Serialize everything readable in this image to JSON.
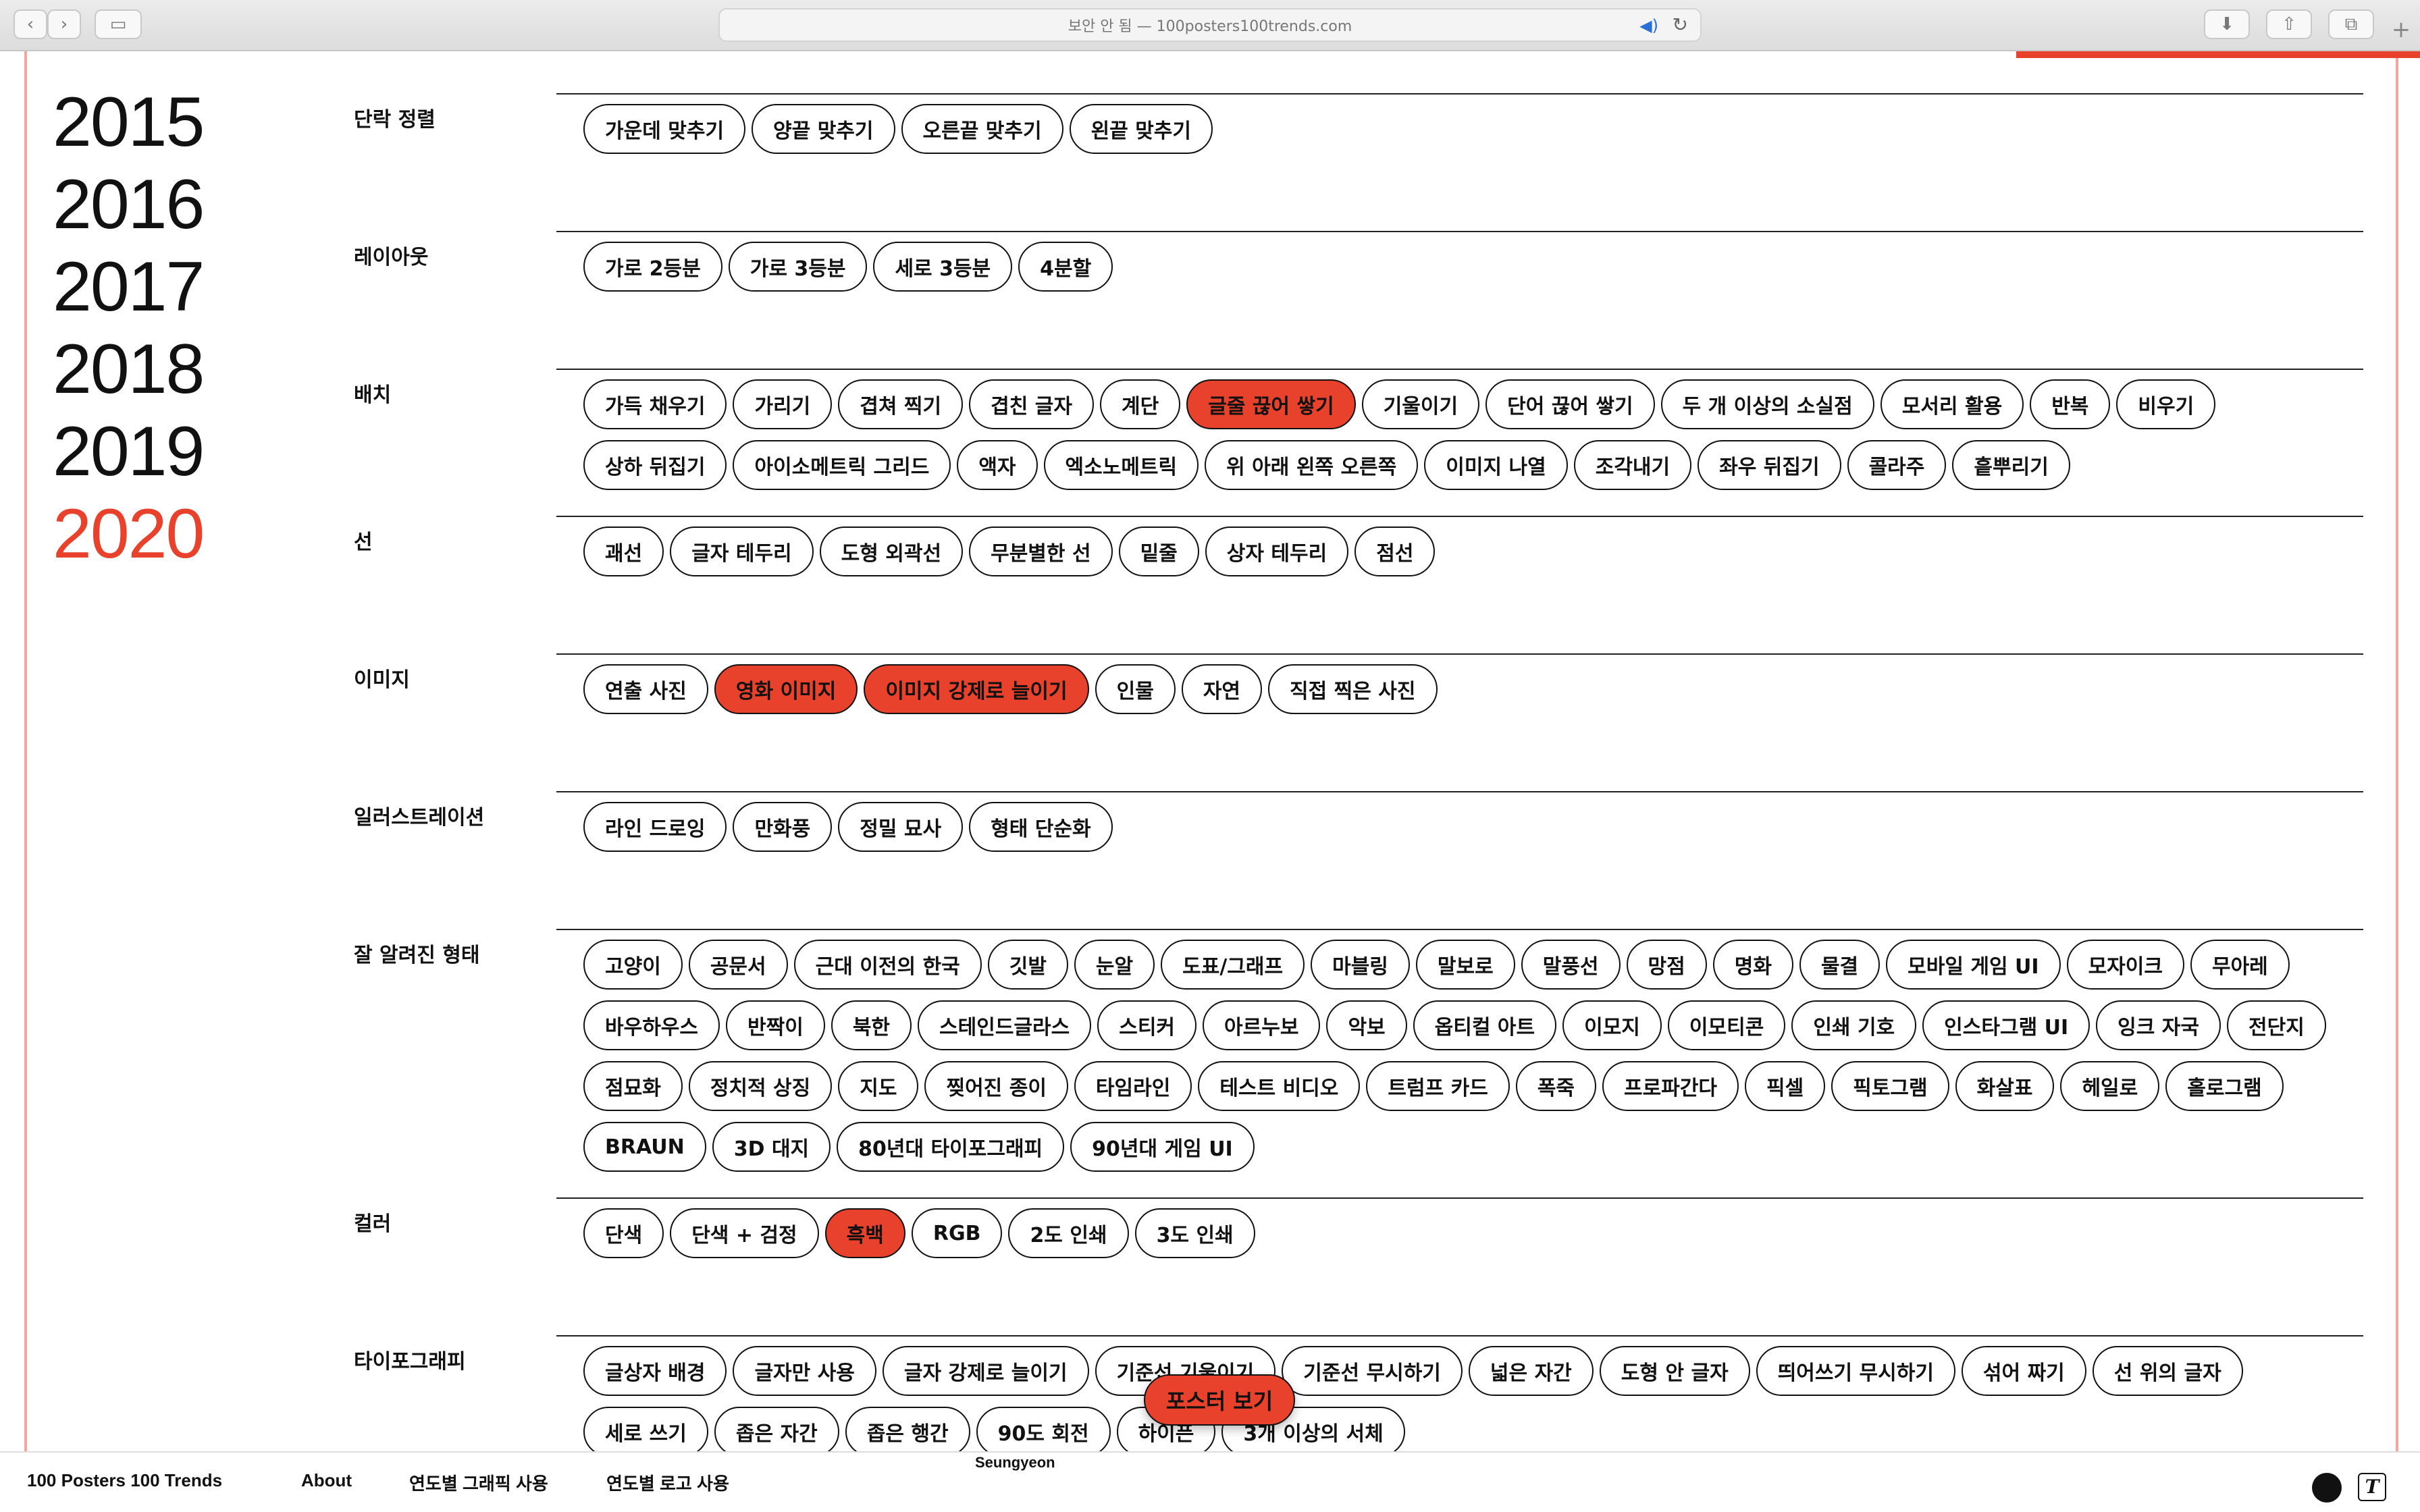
{
  "browser": {
    "address": "보안 안 됨 — 100posters100trends.com"
  },
  "years": [
    {
      "label": "2015",
      "active": false
    },
    {
      "label": "2016",
      "active": false
    },
    {
      "label": "2017",
      "active": false
    },
    {
      "label": "2018",
      "active": false
    },
    {
      "label": "2019",
      "active": false
    },
    {
      "label": "2020",
      "active": true
    }
  ],
  "categories": [
    {
      "title": "단락 정렬",
      "tags": [
        {
          "label": "가운데 맞추기"
        },
        {
          "label": "양끝 맞추기"
        },
        {
          "label": "오른끝 맞추기"
        },
        {
          "label": "왼끝 맞추기"
        }
      ]
    },
    {
      "title": "레이아웃",
      "tags": [
        {
          "label": "가로 2등분"
        },
        {
          "label": "가로 3등분"
        },
        {
          "label": "세로 3등분"
        },
        {
          "label": "4분할"
        }
      ]
    },
    {
      "title": "배치",
      "tags": [
        {
          "label": "가득 채우기"
        },
        {
          "label": "가리기"
        },
        {
          "label": "겹쳐 찍기"
        },
        {
          "label": "겹친 글자"
        },
        {
          "label": "계단"
        },
        {
          "label": "글줄 끊어 쌓기",
          "on": true
        },
        {
          "label": "기울이기"
        },
        {
          "label": "단어 끊어 쌓기"
        },
        {
          "label": "두 개 이상의 소실점"
        },
        {
          "label": "모서리 활용"
        },
        {
          "label": "반복"
        },
        {
          "label": "비우기"
        },
        {
          "label": "상하 뒤집기"
        },
        {
          "label": "아이소메트릭 그리드"
        },
        {
          "label": "액자"
        },
        {
          "label": "엑소노메트릭"
        },
        {
          "label": "위 아래 왼쪽 오른쪽"
        },
        {
          "label": "이미지 나열"
        },
        {
          "label": "조각내기"
        },
        {
          "label": "좌우 뒤집기"
        },
        {
          "label": "콜라주"
        },
        {
          "label": "흩뿌리기"
        }
      ]
    },
    {
      "title": "선",
      "tags": [
        {
          "label": "괘선"
        },
        {
          "label": "글자 테두리"
        },
        {
          "label": "도형 외곽선"
        },
        {
          "label": "무분별한 선"
        },
        {
          "label": "밑줄"
        },
        {
          "label": "상자 테두리"
        },
        {
          "label": "점선"
        }
      ]
    },
    {
      "title": "이미지",
      "tags": [
        {
          "label": "연출 사진"
        },
        {
          "label": "영화 이미지",
          "on": true
        },
        {
          "label": "이미지 강제로 늘이기",
          "on": true
        },
        {
          "label": "인물"
        },
        {
          "label": "자연"
        },
        {
          "label": "직접 찍은 사진"
        }
      ]
    },
    {
      "title": "일러스트레이션",
      "tags": [
        {
          "label": "라인 드로잉"
        },
        {
          "label": "만화풍"
        },
        {
          "label": "정밀 묘사"
        },
        {
          "label": "형태 단순화"
        }
      ]
    },
    {
      "title": "잘 알려진 형태",
      "tags": [
        {
          "label": "고양이"
        },
        {
          "label": "공문서"
        },
        {
          "label": "근대 이전의 한국"
        },
        {
          "label": "깃발"
        },
        {
          "label": "눈알"
        },
        {
          "label": "도표/그래프"
        },
        {
          "label": "마블링"
        },
        {
          "label": "말보로"
        },
        {
          "label": "말풍선"
        },
        {
          "label": "망점"
        },
        {
          "label": "명화"
        },
        {
          "label": "물결"
        },
        {
          "label": "모바일 게임 UI"
        },
        {
          "label": "모자이크"
        },
        {
          "label": "무아레"
        },
        {
          "label": "바우하우스"
        },
        {
          "label": "반짝이"
        },
        {
          "label": "북한"
        },
        {
          "label": "스테인드글라스"
        },
        {
          "label": "스티커"
        },
        {
          "label": "아르누보"
        },
        {
          "label": "악보"
        },
        {
          "label": "옵티컬 아트"
        },
        {
          "label": "이모지"
        },
        {
          "label": "이모티콘"
        },
        {
          "label": "인쇄 기호"
        },
        {
          "label": "인스타그램 UI"
        },
        {
          "label": "잉크 자국"
        },
        {
          "label": "전단지"
        },
        {
          "label": "점묘화"
        },
        {
          "label": "정치적 상징"
        },
        {
          "label": "지도"
        },
        {
          "label": "찢어진 종이"
        },
        {
          "label": "타임라인"
        },
        {
          "label": "테스트 비디오"
        },
        {
          "label": "트럼프 카드"
        },
        {
          "label": "폭죽"
        },
        {
          "label": "프로파간다"
        },
        {
          "label": "픽셀"
        },
        {
          "label": "픽토그램"
        },
        {
          "label": "화살표"
        },
        {
          "label": "헤일로"
        },
        {
          "label": "홀로그램"
        },
        {
          "label": "BRAUN"
        },
        {
          "label": "3D 대지"
        },
        {
          "label": "80년대 타이포그래피"
        },
        {
          "label": "90년대 게임 UI"
        }
      ]
    },
    {
      "title": "컬러",
      "tags": [
        {
          "label": "단색"
        },
        {
          "label": "단색 + 검정"
        },
        {
          "label": "흑백",
          "on": true
        },
        {
          "label": "RGB"
        },
        {
          "label": "2도 인쇄"
        },
        {
          "label": "3도 인쇄"
        }
      ]
    },
    {
      "title": "타이포그래피",
      "tags": [
        {
          "label": "글상자 배경"
        },
        {
          "label": "글자만 사용"
        },
        {
          "label": "글자 강제로 늘이기"
        },
        {
          "label": "기준선 기울이기"
        },
        {
          "label": "기준선 무시하기"
        },
        {
          "label": "넓은 자간"
        },
        {
          "label": "도형 안 글자"
        },
        {
          "label": "띄어쓰기 무시하기"
        },
        {
          "label": "섞어 짜기"
        },
        {
          "label": "선 위의 글자"
        },
        {
          "label": "세로 쓰기"
        },
        {
          "label": "좁은 자간"
        },
        {
          "label": "좁은 행간"
        },
        {
          "label": "90도 회전"
        },
        {
          "label": "하이픈"
        },
        {
          "label": "3개 이상의 서체"
        }
      ]
    }
  ],
  "float_button": {
    "label": "포스터 보기"
  },
  "footer": {
    "site": "100 Posters 100 Trends",
    "about": "About",
    "graphics": "연도별 그래픽 사용",
    "logos": "연도별 로고 사용",
    "credit": "Seungyeon",
    "t_icon": "T"
  },
  "colors": {
    "accent": "#e8412c",
    "ink": "#111111"
  }
}
